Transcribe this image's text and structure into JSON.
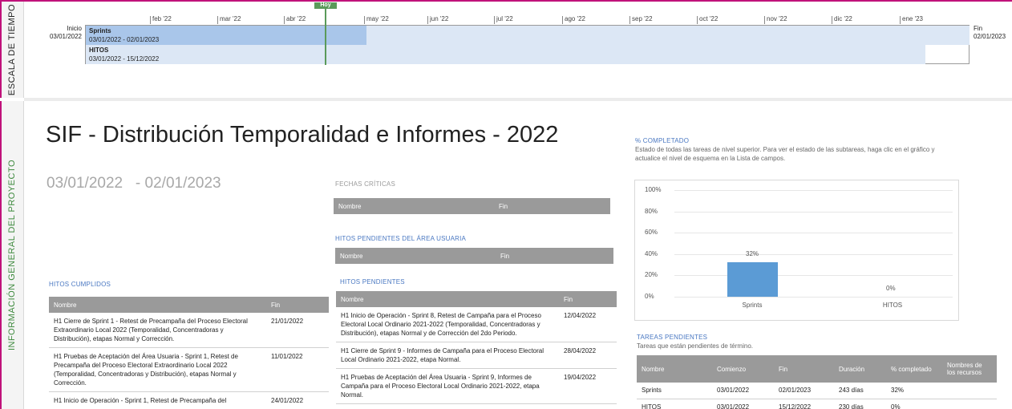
{
  "side_labels": {
    "timescale": "ESCALA DE TIEMPO",
    "project_info": "INFORMACIÓN GENERAL DEL PROYECTO"
  },
  "timeline": {
    "today_label": "Hoy",
    "start_label": "Inicio",
    "start_date": "03/01/2022",
    "finish_label": "Fin",
    "finish_date": "02/01/2023",
    "months": [
      "feb '22",
      "mar '22",
      "abr '22",
      "may '22",
      "jun '22",
      "jul '22",
      "ago '22",
      "sep '22",
      "oct '22",
      "nov '22",
      "dic '22",
      "ene '23"
    ],
    "bars": [
      {
        "name": "Sprints",
        "dates": "03/01/2022 - 02/01/2023",
        "percent_complete": 32
      },
      {
        "name": "HITOS",
        "dates": "03/01/2022 - 15/12/2022",
        "percent_complete": 0
      }
    ]
  },
  "report": {
    "title": "SIF - Distribución Temporalidad e Informes - 2022",
    "date_range": "03/01/2022   - 02/01/2023"
  },
  "critical_dates": {
    "heading": "FECHAS CRÍTICAS",
    "columns": [
      "Nombre",
      "Fin"
    ]
  },
  "user_area_pending": {
    "heading": "HITOS PENDIENTES DEL ÁREA USUARIA",
    "columns": [
      "Nombre",
      "Fin"
    ]
  },
  "milestones_done": {
    "heading": "HITOS CUMPLIDOS",
    "columns": [
      "Nombre",
      "Fin"
    ],
    "rows": [
      {
        "name": "H1 Cierre de Sprint 1 - Retest de Precampaña del Proceso Electoral Extraordinario Local 2022 (Temporalidad, Concentradoras y Distribución), etapas Normal y Corrección.",
        "finish": "21/01/2022"
      },
      {
        "name": "H1 Pruebas de Aceptación del Área Usuaria - Sprint 1, Retest de Precampaña del Proceso Electoral Extraordinario Local 2022 (Temporalidad, Concentradoras y Distribución), etapas Normal y Corrección.",
        "finish": "11/01/2022"
      },
      {
        "name": "H1 Inicio de Operación - Sprint 1, Retest de Precampaña del",
        "finish": "24/01/2022"
      }
    ]
  },
  "milestones_pending": {
    "heading": "HITOS PENDIENTES",
    "columns": [
      "Nombre",
      "Fin"
    ],
    "rows": [
      {
        "name": "H1 Inicio de Operación - Sprint 8, Retest de Campaña para el Proceso Electoral Local Ordinario 2021-2022 (Temporalidad, Concentradoras y Distribución), etapas Normal y de Corrección del 2do Periodo.",
        "finish": "12/04/2022"
      },
      {
        "name": "H1 Cierre de Sprint 9 - Informes de Campaña para el Proceso Electoral Local Ordinario 2021-2022, etapa Normal.",
        "finish": "28/04/2022"
      },
      {
        "name": "H1 Pruebas de Aceptación del Área Usuaria - Sprint 9, Informes de Campaña para el Proceso Electoral Local Ordinario 2021-2022, etapa Normal.",
        "finish": "19/04/2022"
      }
    ]
  },
  "percent_complete": {
    "heading": "% COMPLETADO",
    "description": "Estado de todas las tareas de nivel superior. Para ver el estado de las subtareas, haga clic en el gráfico y actualice el nivel de esquema en la Lista de campos."
  },
  "chart_data": {
    "type": "bar",
    "categories": [
      "Sprints",
      "HITOS"
    ],
    "values": [
      32,
      0
    ],
    "data_labels": [
      "32%",
      "0%"
    ],
    "y_ticks": [
      "0%",
      "20%",
      "40%",
      "60%",
      "80%",
      "100%"
    ],
    "ylim": [
      0,
      100
    ],
    "grid": true,
    "bar_color": "#5b9bd5"
  },
  "pending_tasks": {
    "heading": "TAREAS PENDIENTES",
    "description": "Tareas que están pendientes de término.",
    "columns": [
      "Nombre",
      "Comienzo",
      "Fin",
      "Duración",
      "% completado",
      "Nombres de los recursos"
    ],
    "rows": [
      {
        "name": "Sprints",
        "start": "03/01/2022",
        "finish": "02/01/2023",
        "duration": "243 días",
        "pct": "32%",
        "resources": ""
      },
      {
        "name": "HITOS",
        "start": "03/01/2022",
        "finish": "15/12/2022",
        "duration": "230 días",
        "pct": "0%",
        "resources": ""
      }
    ]
  },
  "colors": {
    "accent_pink": "#c0127a",
    "today_green": "#5a9a5a",
    "heading_blue": "#4a78c2",
    "bar_progress": "#a9c6ea",
    "bar_remaining": "#dce7f5",
    "table_header": "#9a9a9a"
  }
}
